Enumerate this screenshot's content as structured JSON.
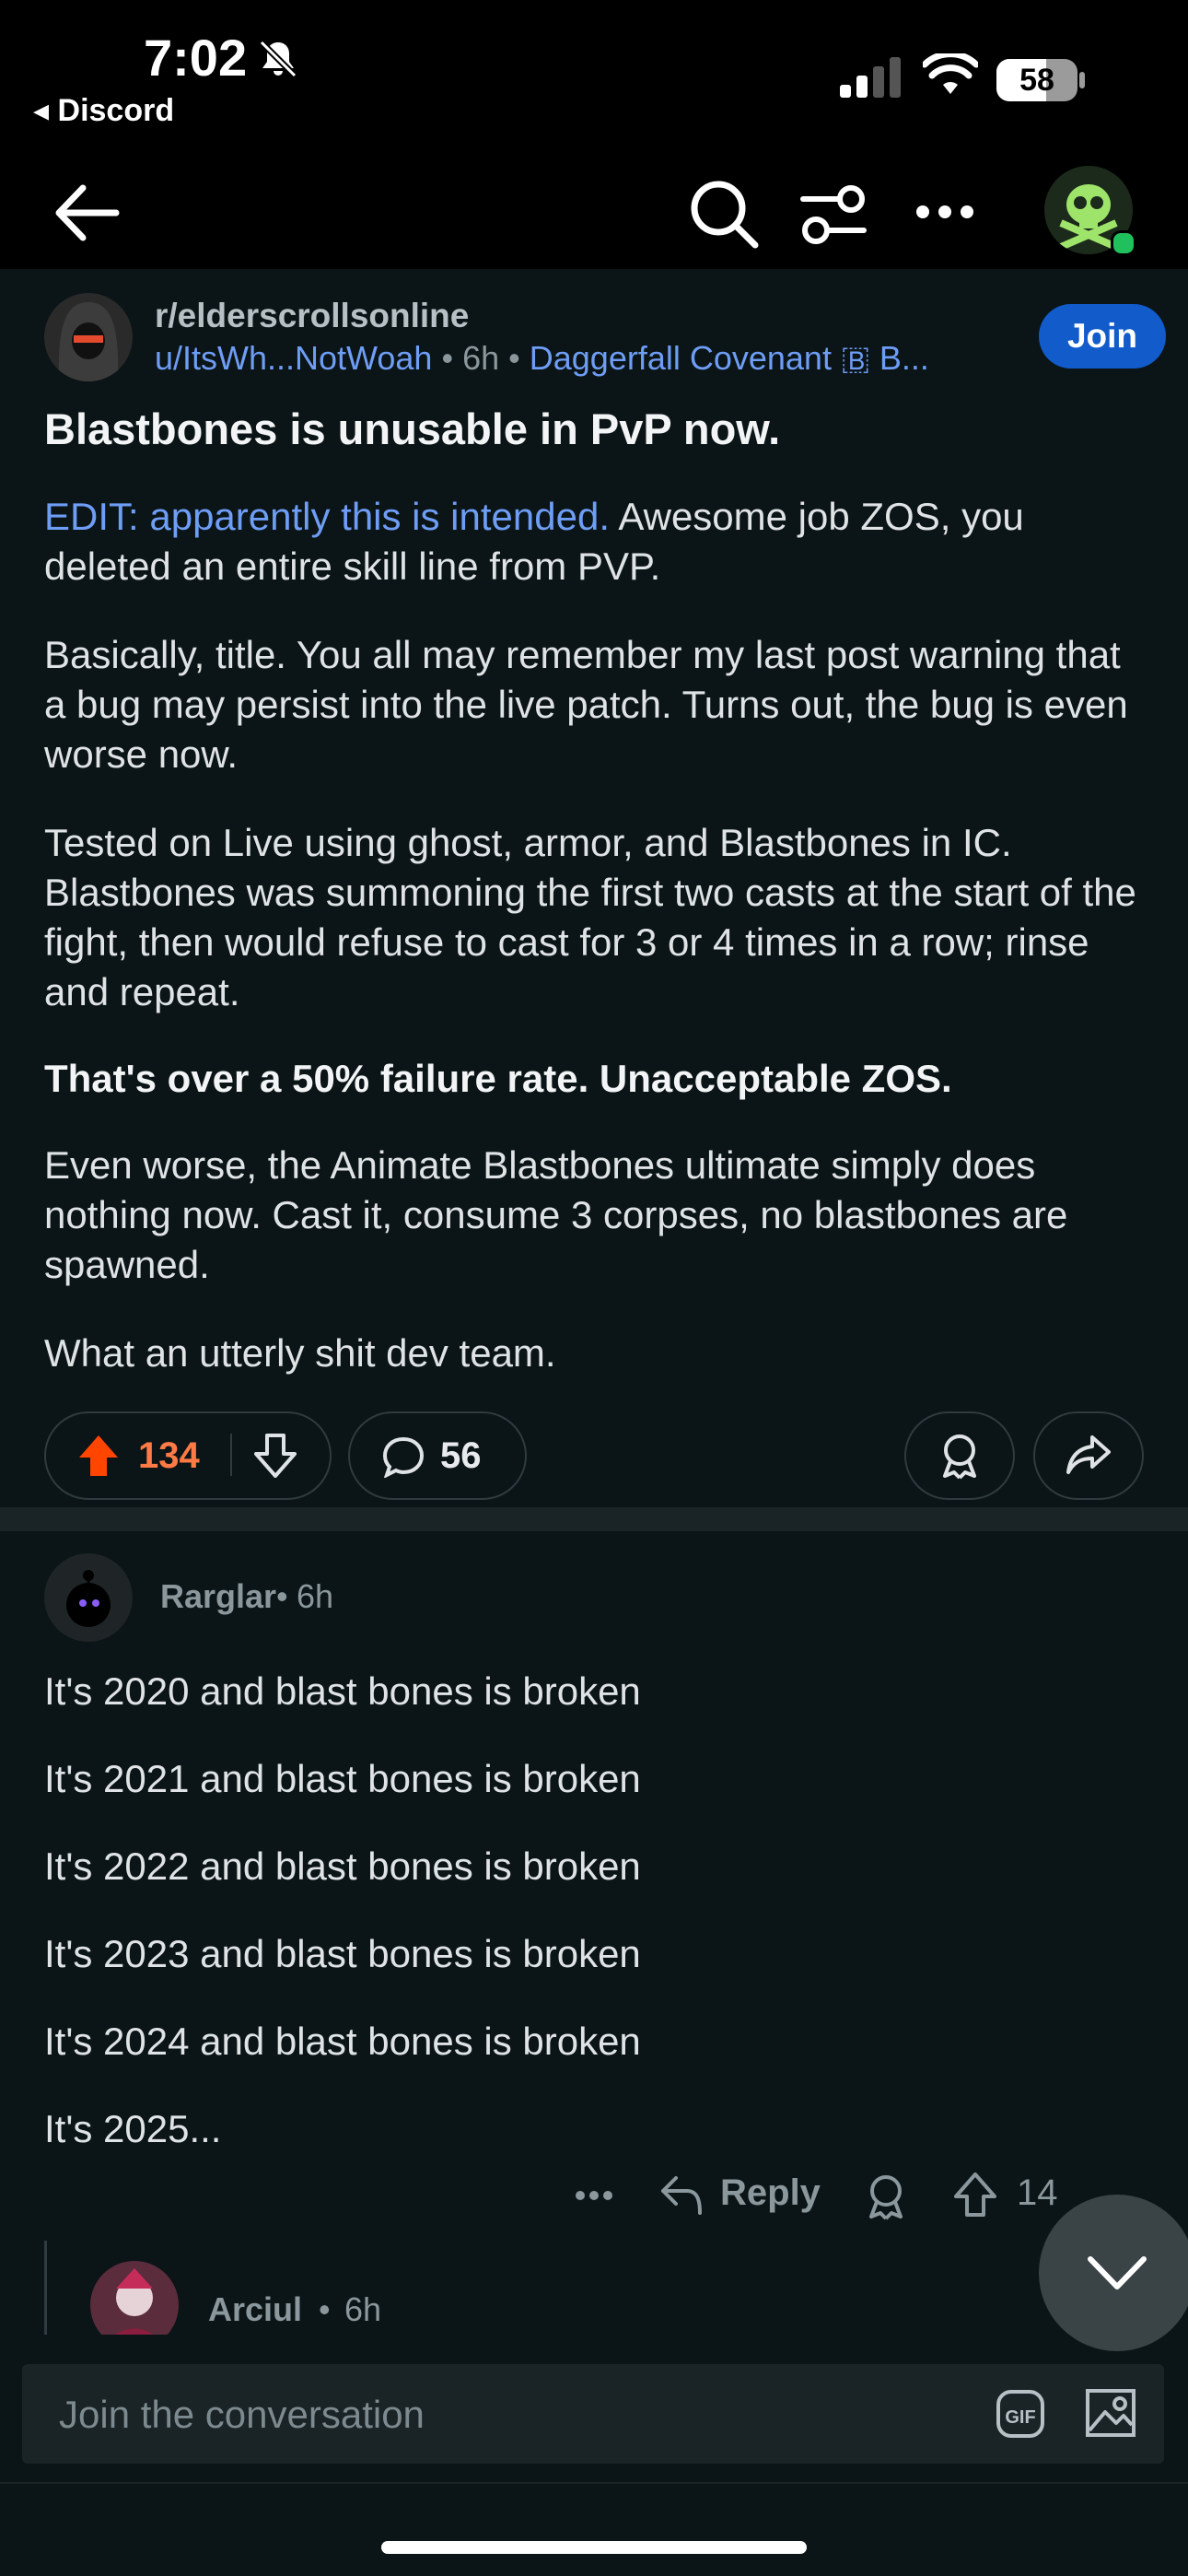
{
  "status": {
    "time": "7:02",
    "back_app": "◂ Discord",
    "battery": "58"
  },
  "post": {
    "subreddit": "r/elderscrollsonline",
    "author": "u/ItsWh...NotWoah",
    "age": "6h",
    "flair": "Daggerfall Covenant 🇧 B...",
    "join_label": "Join",
    "title": "Blastbones is unusable in PvP now.",
    "edit_link": "EDIT: apparently this is intended.",
    "edit_rest": " Awesome job ZOS, you deleted an entire skill line from PVP.",
    "p1": "Basically, title. You all may remember my last post warning that a bug may persist into the live patch. Turns out, the bug is even worse now.",
    "p2": "Tested on Live using ghost, armor, and Blastbones in IC. Blastbones was summoning the first two casts at the start of the fight, then would refuse to cast for 3 or 4 times in a row; rinse and repeat.",
    "p3": "That's over a 50% failure rate. Unacceptable ZOS.",
    "p4": "Even worse, the Animate Blastbones ultimate simply does nothing now. Cast it, consume 3 corpses, no blastbones are spawned.",
    "p5": "What an utterly shit dev team.",
    "upvotes": "134",
    "comments": "56"
  },
  "comment": {
    "author": "Rarglar",
    "age": "6h",
    "lines": [
      "It's 2020 and blast bones is broken",
      "It's 2021 and blast bones is broken",
      "It's 2022 and blast bones is broken",
      "It's 2023 and blast bones is broken",
      "It's 2024 and blast bones is broken",
      "It's 2025..."
    ],
    "reply_label": "Reply",
    "votes": "14"
  },
  "reply": {
    "author": "Arciul",
    "age": "6h"
  },
  "composer": {
    "placeholder": "Join the conversation",
    "gif_label": "GIF"
  }
}
